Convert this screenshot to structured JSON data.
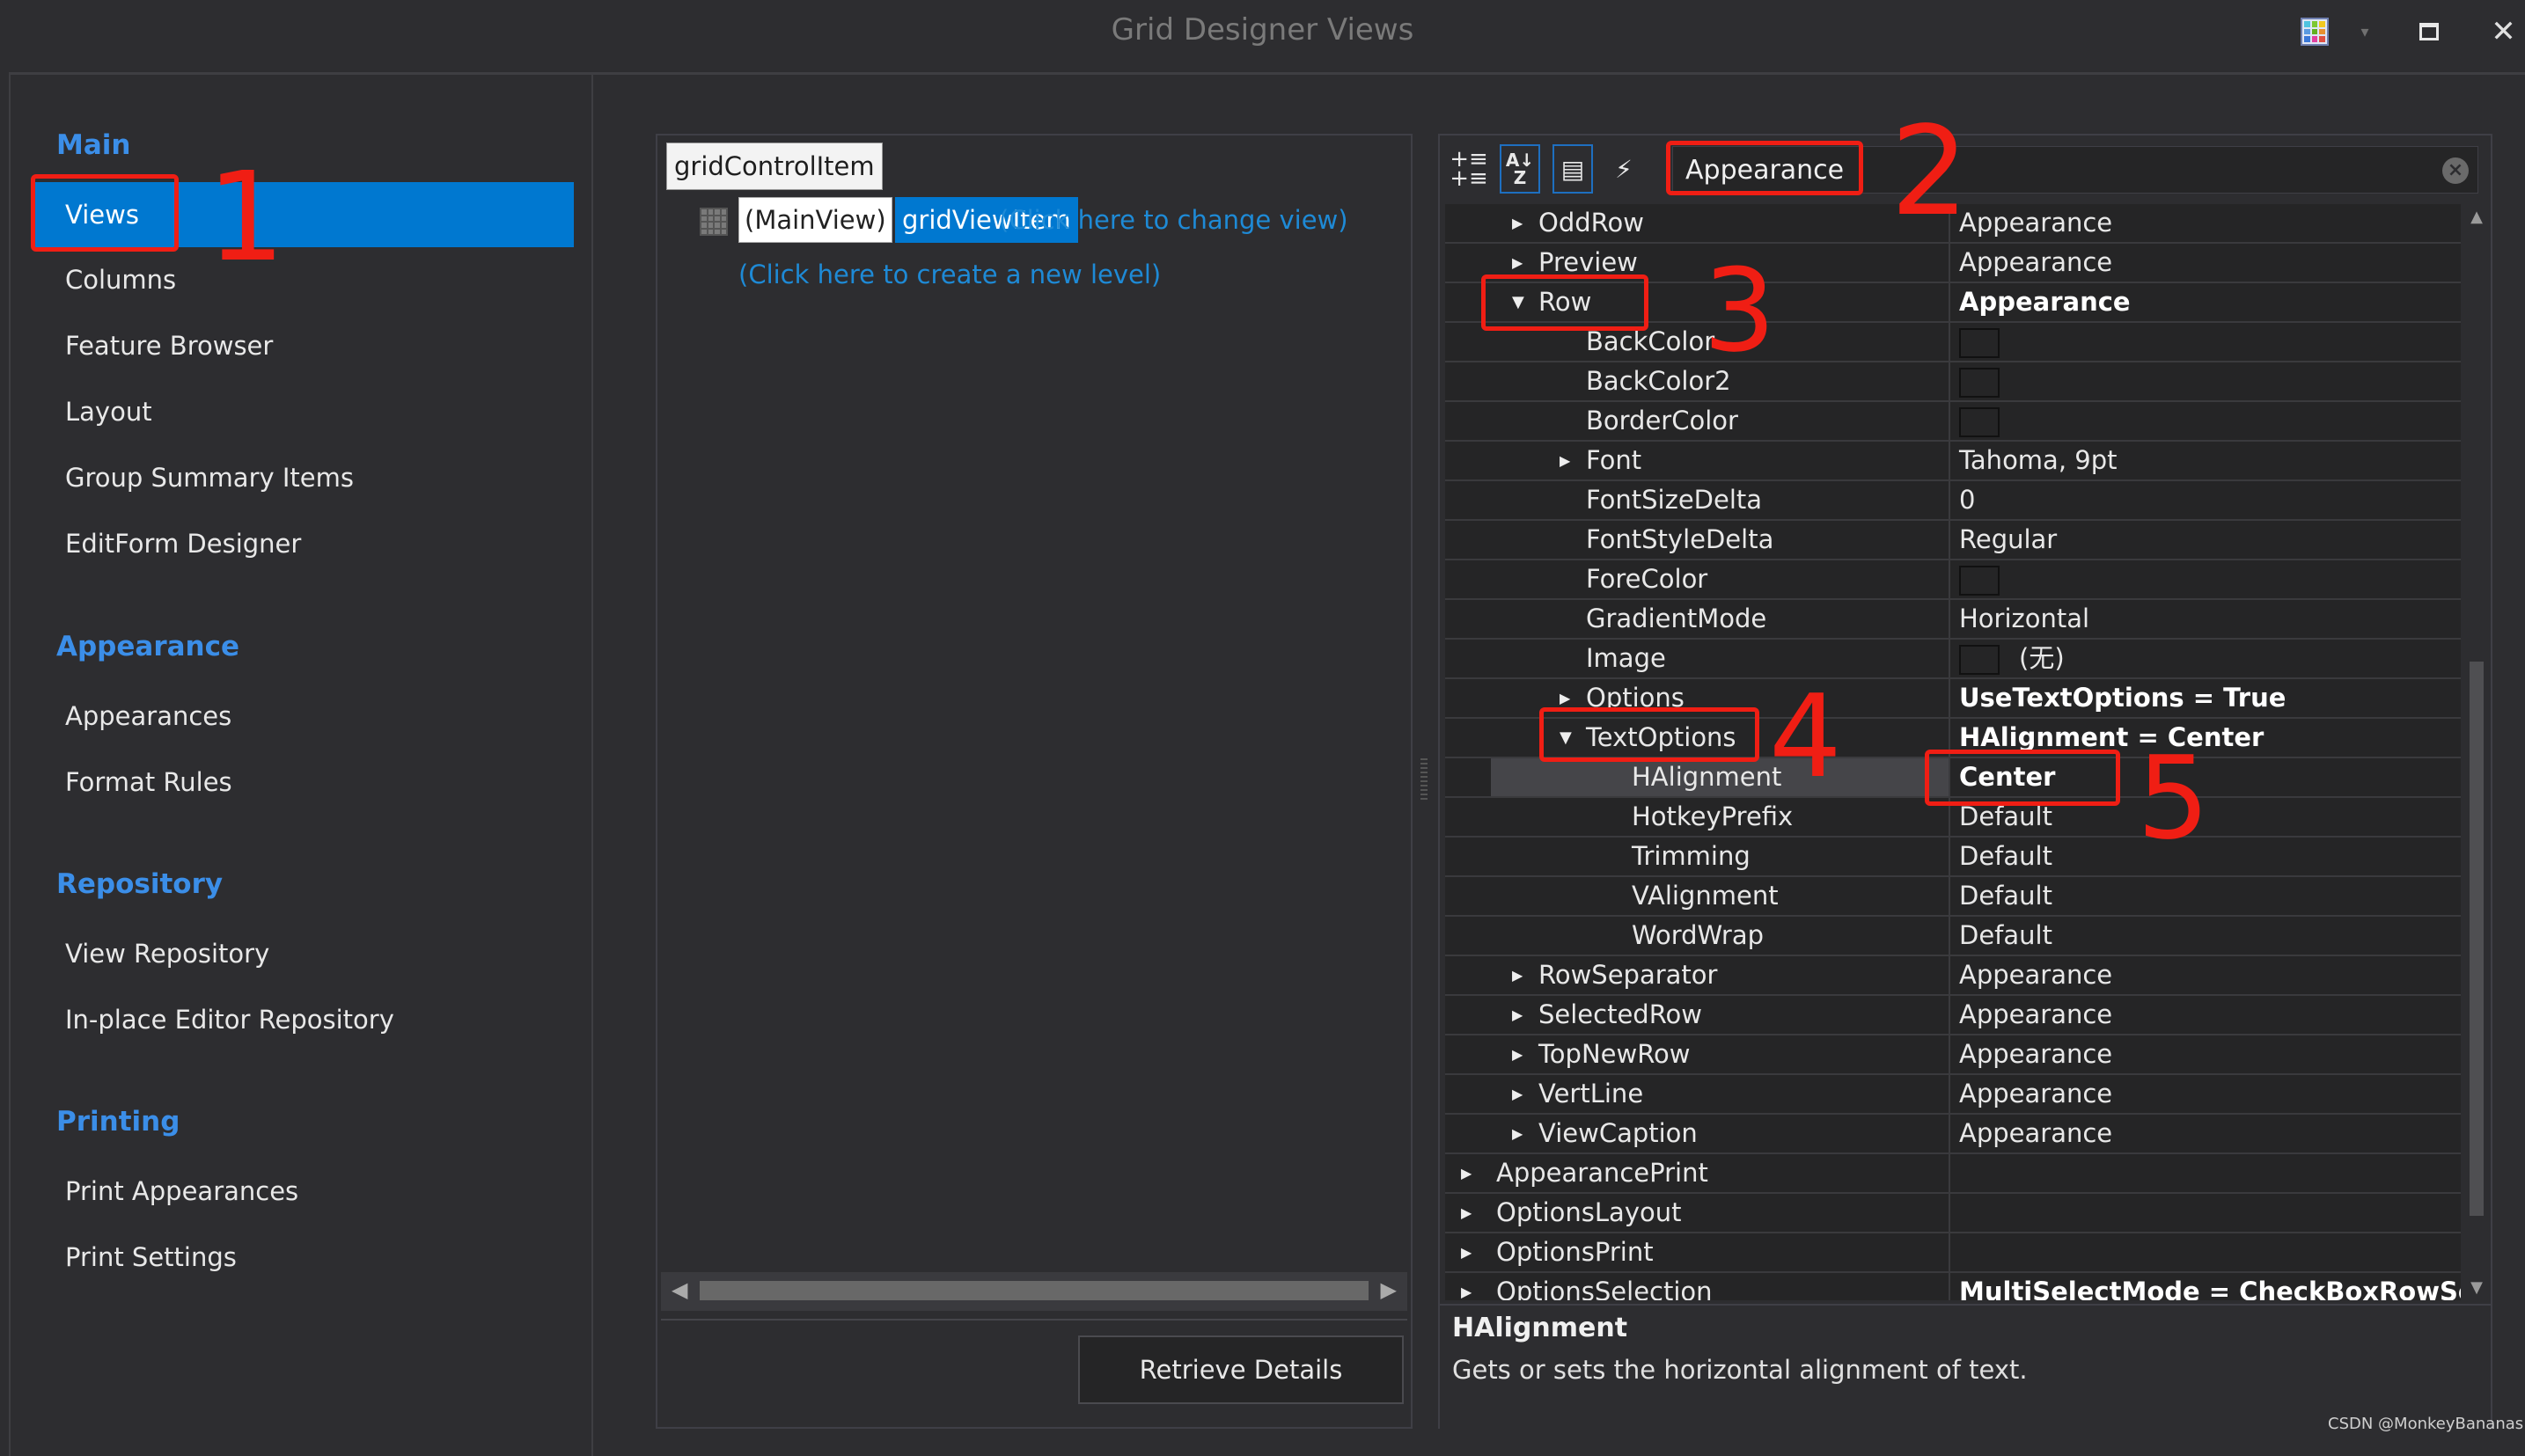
{
  "window": {
    "title": "Grid Designer Views",
    "controls": {
      "palette": "palette-icon",
      "dropdown": "▾",
      "maximize": "maximize-icon",
      "close": "✕"
    }
  },
  "sidebar": {
    "groups": [
      {
        "header": "Main",
        "items": [
          {
            "label": "Views",
            "selected": true
          },
          {
            "label": "Columns"
          },
          {
            "label": "Feature Browser"
          },
          {
            "label": "Layout"
          },
          {
            "label": "Group Summary Items"
          },
          {
            "label": "EditForm Designer"
          }
        ]
      },
      {
        "header": "Appearance",
        "items": [
          {
            "label": "Appearances"
          },
          {
            "label": "Format Rules"
          }
        ]
      },
      {
        "header": "Repository",
        "items": [
          {
            "label": "View Repository"
          },
          {
            "label": "In-place Editor Repository"
          }
        ]
      },
      {
        "header": "Printing",
        "items": [
          {
            "label": "Print Appearances"
          },
          {
            "label": "Print Settings"
          }
        ]
      }
    ]
  },
  "levels": {
    "root": "gridControlItem",
    "main_view": "(MainView)",
    "view_item": "gridViewItem",
    "change_view_link": "(Click here to change view)",
    "new_level_link": "(Click here to create a new level)",
    "retrieve_button": "Retrieve Details"
  },
  "properties": {
    "toolbar": {
      "categorized": "categorized-icon",
      "alphabetical": "AZ",
      "property_pages": "property-pages-icon",
      "events": "⚡"
    },
    "search": {
      "value": "Appearance"
    },
    "rows": [
      {
        "name": "OddRow",
        "value": "Appearance",
        "level": 1,
        "expander": "collapsed"
      },
      {
        "name": "Preview",
        "value": "Appearance",
        "level": 1,
        "expander": "collapsed"
      },
      {
        "name": "Row",
        "value": "Appearance",
        "level": 1,
        "expander": "expanded",
        "bold": true
      },
      {
        "name": "BackColor",
        "value": "",
        "level": 2,
        "swatch": true
      },
      {
        "name": "BackColor2",
        "value": "",
        "level": 2,
        "swatch": true
      },
      {
        "name": "BorderColor",
        "value": "",
        "level": 2,
        "swatch": true
      },
      {
        "name": "Font",
        "value": "Tahoma, 9pt",
        "level": 2,
        "expander": "collapsed"
      },
      {
        "name": "FontSizeDelta",
        "value": "0",
        "level": 2
      },
      {
        "name": "FontStyleDelta",
        "value": "Regular",
        "level": 2
      },
      {
        "name": "ForeColor",
        "value": "",
        "level": 2,
        "swatch": true
      },
      {
        "name": "GradientMode",
        "value": "Horizontal",
        "level": 2
      },
      {
        "name": "Image",
        "value": "(无)",
        "level": 2,
        "swatch": true
      },
      {
        "name": "Options",
        "value": "UseTextOptions = True",
        "level": 2,
        "expander": "collapsed",
        "bold": true
      },
      {
        "name": "TextOptions",
        "value": "HAlignment = Center",
        "level": 2,
        "expander": "expanded",
        "bold": true
      },
      {
        "name": "HAlignment",
        "value": "Center",
        "level": 3,
        "bold": true,
        "selected": true
      },
      {
        "name": "HotkeyPrefix",
        "value": "Default",
        "level": 3
      },
      {
        "name": "Trimming",
        "value": "Default",
        "level": 3
      },
      {
        "name": "VAlignment",
        "value": "Default",
        "level": 3
      },
      {
        "name": "WordWrap",
        "value": "Default",
        "level": 3
      },
      {
        "name": "RowSeparator",
        "value": "Appearance",
        "level": 1,
        "expander": "collapsed"
      },
      {
        "name": "SelectedRow",
        "value": "Appearance",
        "level": 1,
        "expander": "collapsed"
      },
      {
        "name": "TopNewRow",
        "value": "Appearance",
        "level": 1,
        "expander": "collapsed"
      },
      {
        "name": "VertLine",
        "value": "Appearance",
        "level": 1,
        "expander": "collapsed"
      },
      {
        "name": "ViewCaption",
        "value": "Appearance",
        "level": 1,
        "expander": "collapsed"
      },
      {
        "name": "AppearancePrint",
        "value": "",
        "level": 0,
        "expander": "collapsed"
      },
      {
        "name": "OptionsLayout",
        "value": "",
        "level": 0,
        "expander": "collapsed"
      },
      {
        "name": "OptionsPrint",
        "value": "",
        "level": 0,
        "expander": "collapsed"
      },
      {
        "name": "OptionsSelection",
        "value": "MultiSelectMode = CheckBoxRowSelect",
        "level": 0,
        "expander": "collapsed",
        "bold": true
      }
    ],
    "description": {
      "title": "HAlignment",
      "text": "Gets or sets the horizontal alignment of text."
    }
  },
  "annotations": [
    "1",
    "2",
    "3",
    "4",
    "5"
  ],
  "watermark": "CSDN @MonkeyBananas",
  "colors": {
    "accent": "#0078d0",
    "link": "#1e8ad6",
    "header": "#3b8ee8",
    "annotation": "#f01e14"
  }
}
